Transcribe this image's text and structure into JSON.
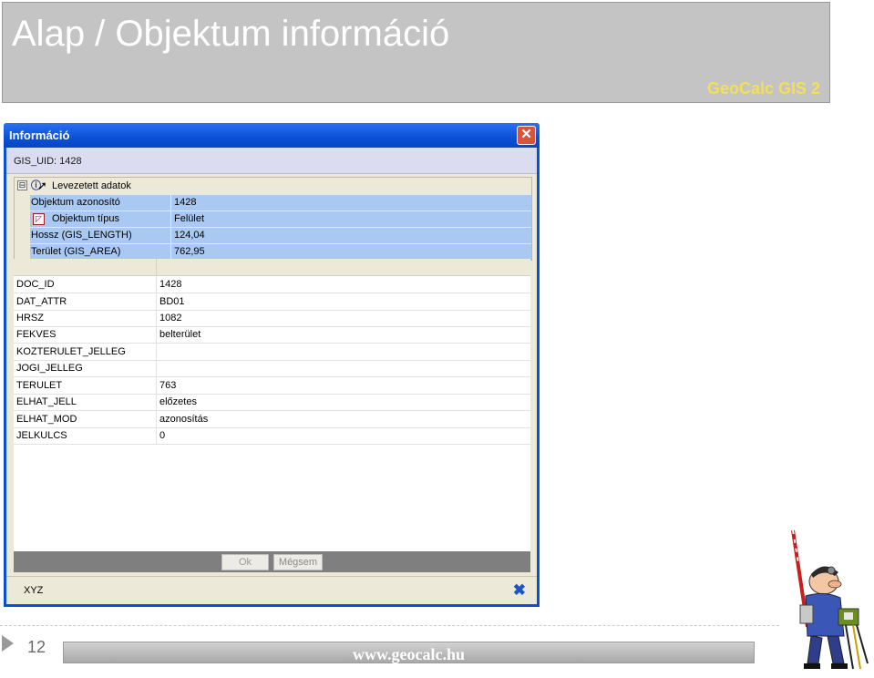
{
  "slide": {
    "title": "Alap / Objektum információ",
    "brand": "GeoCalc GIS 2",
    "page_number": "12",
    "footer_url": "www.geocalc.hu"
  },
  "dialog": {
    "title": "Információ",
    "close_icon": "close-x-icon",
    "uid_label": "GIS_UID: 1428",
    "derived_group": {
      "title": "Levezetett adatok",
      "expander": "⊟",
      "rows": [
        {
          "key": "Objektum azonosító",
          "value": "1428"
        },
        {
          "key": "Objektum típus",
          "value": "Felület"
        },
        {
          "key": "Hossz (GIS_LENGTH)",
          "value": "124,04"
        },
        {
          "key": "Terület (GIS_AREA)",
          "value": "762,95"
        }
      ]
    },
    "attributes": [
      {
        "key": "DOC_ID",
        "value": "1428"
      },
      {
        "key": "DAT_ATTR",
        "value": "BD01"
      },
      {
        "key": "HRSZ",
        "value": "1082"
      },
      {
        "key": "FEKVES",
        "value": "belterület"
      },
      {
        "key": "KOZTERULET_JELLEG",
        "value": ""
      },
      {
        "key": "JOGI_JELLEG",
        "value": ""
      },
      {
        "key": "TERULET",
        "value": "763"
      },
      {
        "key": "ELHAT_JELL",
        "value": "előzetes"
      },
      {
        "key": "ELHAT_MOD",
        "value": "azonosítás"
      },
      {
        "key": "JELKULCS",
        "value": "0"
      }
    ],
    "buttons": {
      "ok": "Ok",
      "cancel": "Mégsem"
    },
    "bottom": {
      "xyz_label": "XYZ"
    }
  },
  "colors": {
    "title_bar": "#0a50d6",
    "derived_row": "#a9c8f2",
    "brand_text": "#f3df58"
  }
}
